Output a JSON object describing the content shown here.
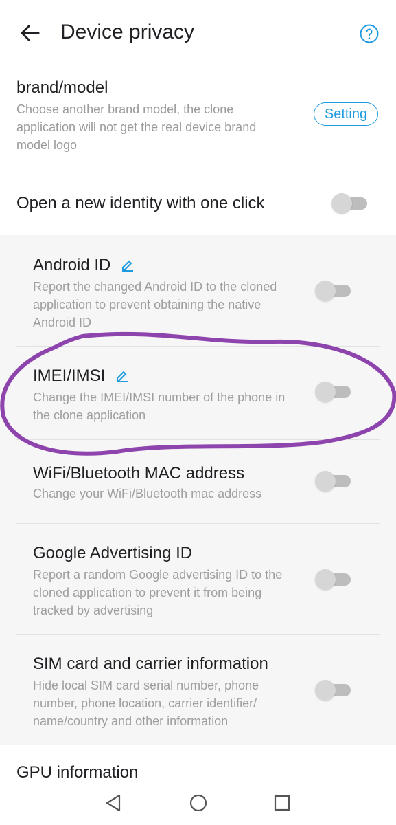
{
  "header": {
    "title": "Device privacy"
  },
  "brand": {
    "title": "brand/model",
    "description": "Choose another brand model, the clone application will not get the real device brand model logo",
    "button_label": "Setting"
  },
  "onekey": {
    "label": "Open a new identity with one click"
  },
  "items": [
    {
      "title": "Android ID",
      "description": "Report the changed Android ID to the cloned application to prevent obtaining the native Android ID",
      "editable": true
    },
    {
      "title": "IMEI/IMSI",
      "description": "Change the IMEI/IMSI number of the phone in the clone application",
      "editable": true
    },
    {
      "title": "WiFi/Bluetooth MAC address",
      "description": "Change your WiFi/Bluetooth mac address",
      "editable": false
    },
    {
      "title": "Google Advertising ID",
      "description": "Report a random Google advertising ID to the cloned application to prevent it from being tracked by advertising",
      "editable": false
    },
    {
      "title": "SIM card and carrier information",
      "description": "Hide local SIM card serial number, phone number, phone location, carrier identifier/ name/country and other information",
      "editable": false
    }
  ],
  "gpu": {
    "label": "GPU information"
  },
  "colors": {
    "accent": "#1e9be0",
    "annotation": "#8e44ad"
  },
  "icons": [
    "arrow-left-icon",
    "help-circle-icon",
    "pencil-icon",
    "nav-back-icon",
    "nav-home-icon",
    "nav-recent-icon"
  ]
}
